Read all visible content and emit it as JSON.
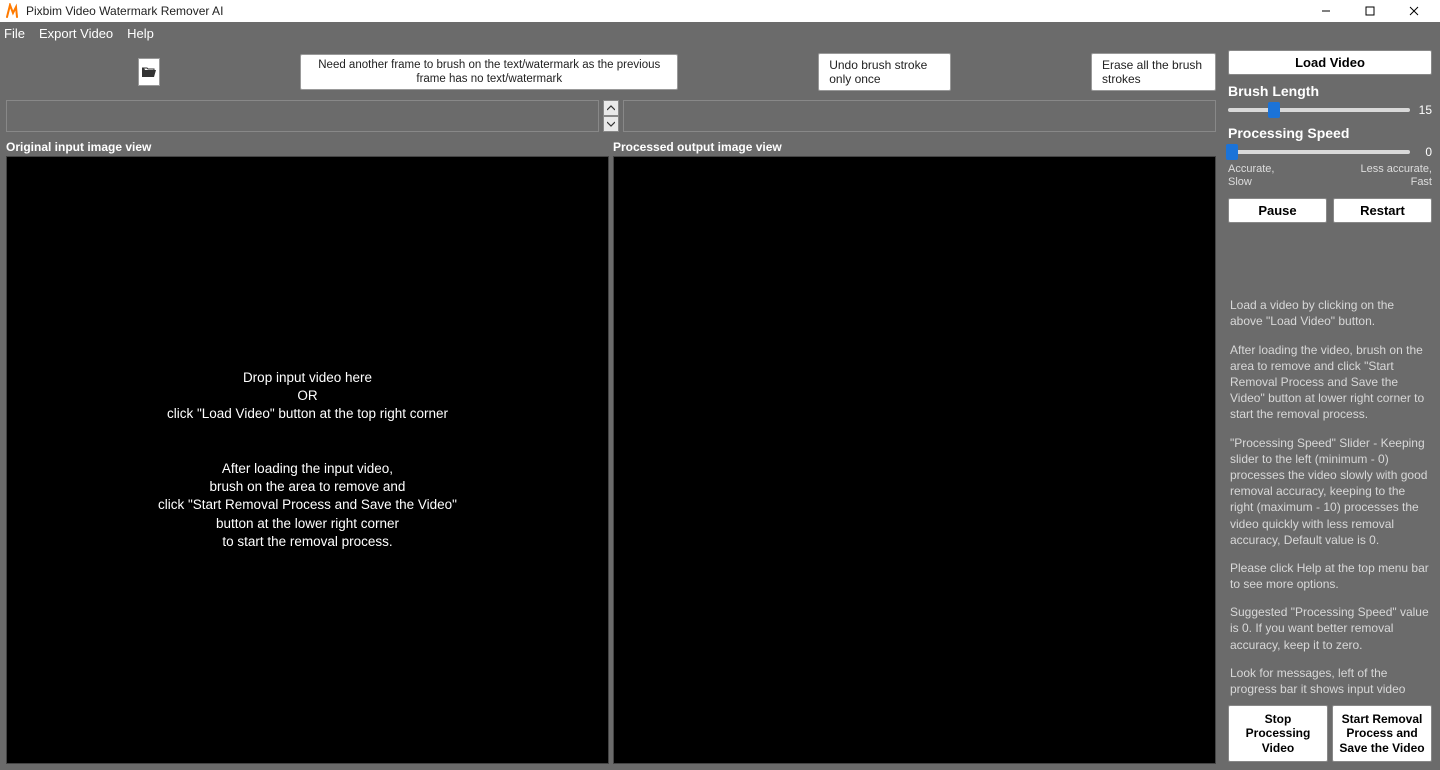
{
  "window": {
    "title": "Pixbim Video Watermark Remover AI"
  },
  "menu": {
    "file": "File",
    "export": "Export Video",
    "help": "Help"
  },
  "toolbar": {
    "hint": "Need another frame to brush on the text/watermark\nas the previous frame has no text/watermark",
    "undo": "Undo brush stroke only once",
    "erase": "Erase all the brush strokes"
  },
  "views": {
    "input_label": "Original input image view",
    "output_label": "Processed output image view",
    "input_placeholder": "Drop input video here\nOR\nclick \"Load Video\" button at the top right corner\n\n\nAfter loading the input video,\nbrush on the area to remove and\nclick \"Start Removal Process and Save the Video\"\nbutton at the lower right corner\nto start the removal process."
  },
  "panel": {
    "load": "Load Video",
    "brush_label": "Brush Length",
    "brush_value": "15",
    "brush_pos_pct": 25,
    "speed_label": "Processing Speed",
    "speed_value": "0",
    "speed_pos_pct": 2,
    "speed_left": "Accurate,\nSlow",
    "speed_right": "Less accurate,\nFast",
    "pause": "Pause",
    "restart": "Restart",
    "stop": "Stop Processing Video",
    "start": "Start Removal Process and Save the Video"
  },
  "info": {
    "p1": "Load a video by clicking on the above \"Load Video\" button.",
    "p2": "After loading the video, brush on the area to remove and click \"Start Removal Process and Save the Video\" button at lower right corner to start the removal process.",
    "p3": "\"Processing Speed\" Slider - Keeping slider to the left (minimum - 0) processes the video slowly with good removal accuracy, keeping to the right (maximum - 10) processes the video quickly with less removal accuracy, Default value is 0.",
    "p4": "Please click Help at the top menu bar to see more options.",
    "p5": "Suggested \"Processing Speed\" value is 0. If you want better removal accuracy, keep it to zero.",
    "p6": "Look for messages, left of the progress bar it shows input video path, output video path and status information"
  }
}
